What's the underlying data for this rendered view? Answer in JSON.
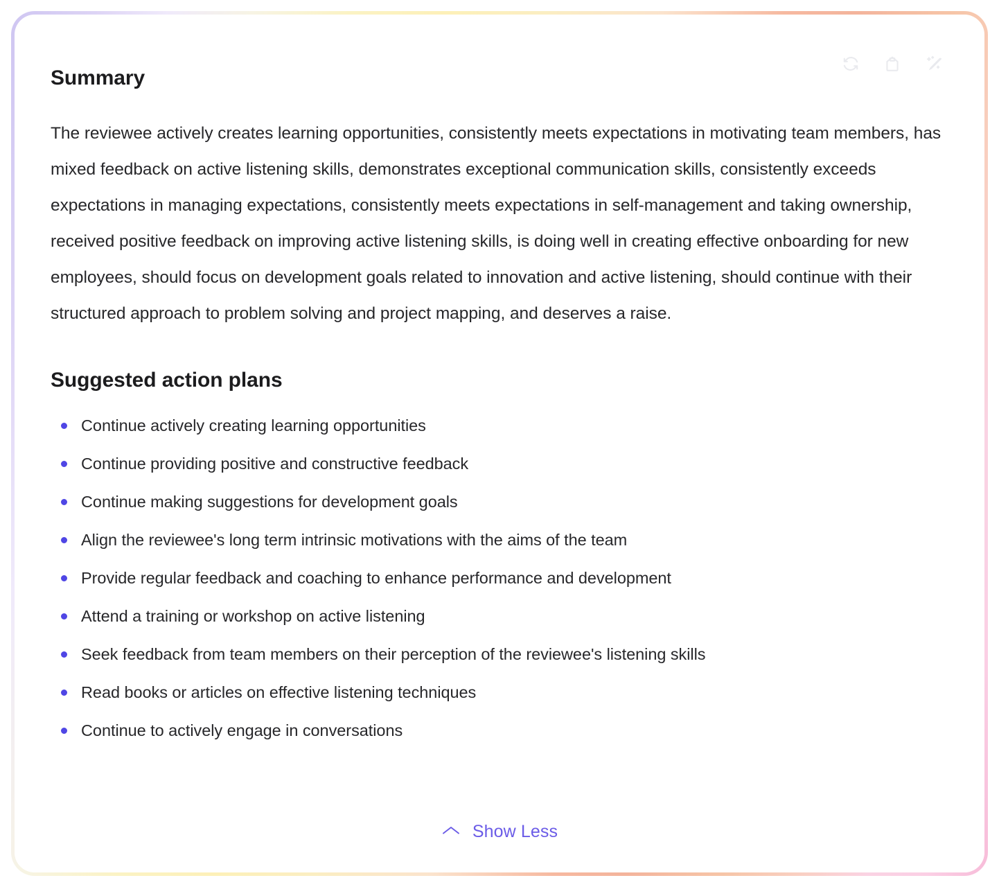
{
  "card": {
    "border_gradient": [
      "#cfc6f2",
      "#fbf3c4",
      "#f4b49c",
      "#f7bcd9"
    ],
    "background": "#ffffff"
  },
  "toolbar": {
    "icons": [
      {
        "name": "regenerate-icon",
        "label": "Regenerate"
      },
      {
        "name": "copy-icon",
        "label": "Copy"
      },
      {
        "name": "magic-wand-icon",
        "label": "Rewrite with AI"
      }
    ]
  },
  "summary": {
    "heading": "Summary",
    "body": "The reviewee actively creates learning opportunities, consistently meets expectations in motivating team members, has mixed feedback on active listening skills, demonstrates exceptional communication skills, consistently exceeds expectations in managing expectations, consistently meets expectations in self-management and taking ownership, received positive feedback on improving active listening skills, is doing well in creating effective onboarding for new employees, should focus on development goals related to innovation and active listening, should continue with their structured approach to problem solving and project mapping, and deserves a raise."
  },
  "action_plans": {
    "heading": "Suggested action plans",
    "bullet_color": "#4f46e5",
    "items": [
      "Continue actively creating learning opportunities",
      "Continue providing positive and constructive feedback",
      "Continue making suggestions for development goals",
      "Align the reviewee's long term intrinsic motivations with the aims of the team",
      "Provide regular feedback and coaching to enhance performance and development",
      "Attend a training or workshop on active listening",
      "Seek feedback from team members on their perception of the reviewee's listening skills",
      "Read books or articles on effective listening techniques",
      "Continue to actively engage in conversations"
    ]
  },
  "footer": {
    "show_less_label": "Show Less",
    "show_less_color": "#6b5ce7",
    "chevron": "chevron-up-icon"
  }
}
